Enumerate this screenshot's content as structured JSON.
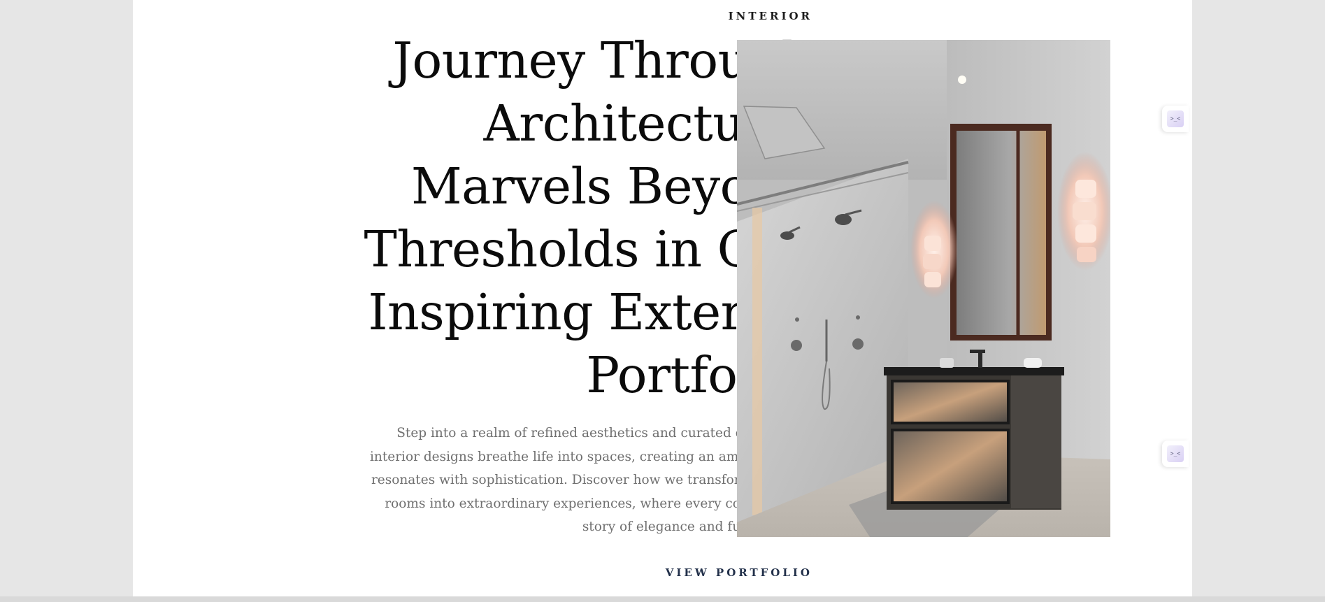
{
  "section": {
    "eyebrow": "INTERIOR",
    "headline_lines": [
      "Journey Through",
      "Architectural",
      "Marvels Beyond",
      "Thresholds in Our",
      "Inspiring Exterior",
      "Portfolio."
    ],
    "description": "Step into a realm of refined aesthetics and curated details. Our interior designs breathe life into spaces, creating an ambiance that resonates with sophistication. Discover how we transform ordinary rooms into extraordinary experiences, where every corner tells a story of elegance and functionality.",
    "cta_label": "VIEW PORTFOLIO"
  },
  "image": {
    "subject": "modern bathroom interior with walk-in shower, wall-mounted vanity, mirror cabinet and sconce lights"
  },
  "side_widgets": [
    {
      "icon": "assistant-face-icon",
      "glyph": ">_<"
    },
    {
      "icon": "assistant-face-icon",
      "glyph": ">_<"
    }
  ],
  "colors": {
    "background": "#e6e6e6",
    "page": "#ffffff",
    "headline": "#0b0b0b",
    "body_text": "#6f6f6f",
    "cta": "#22304a"
  }
}
